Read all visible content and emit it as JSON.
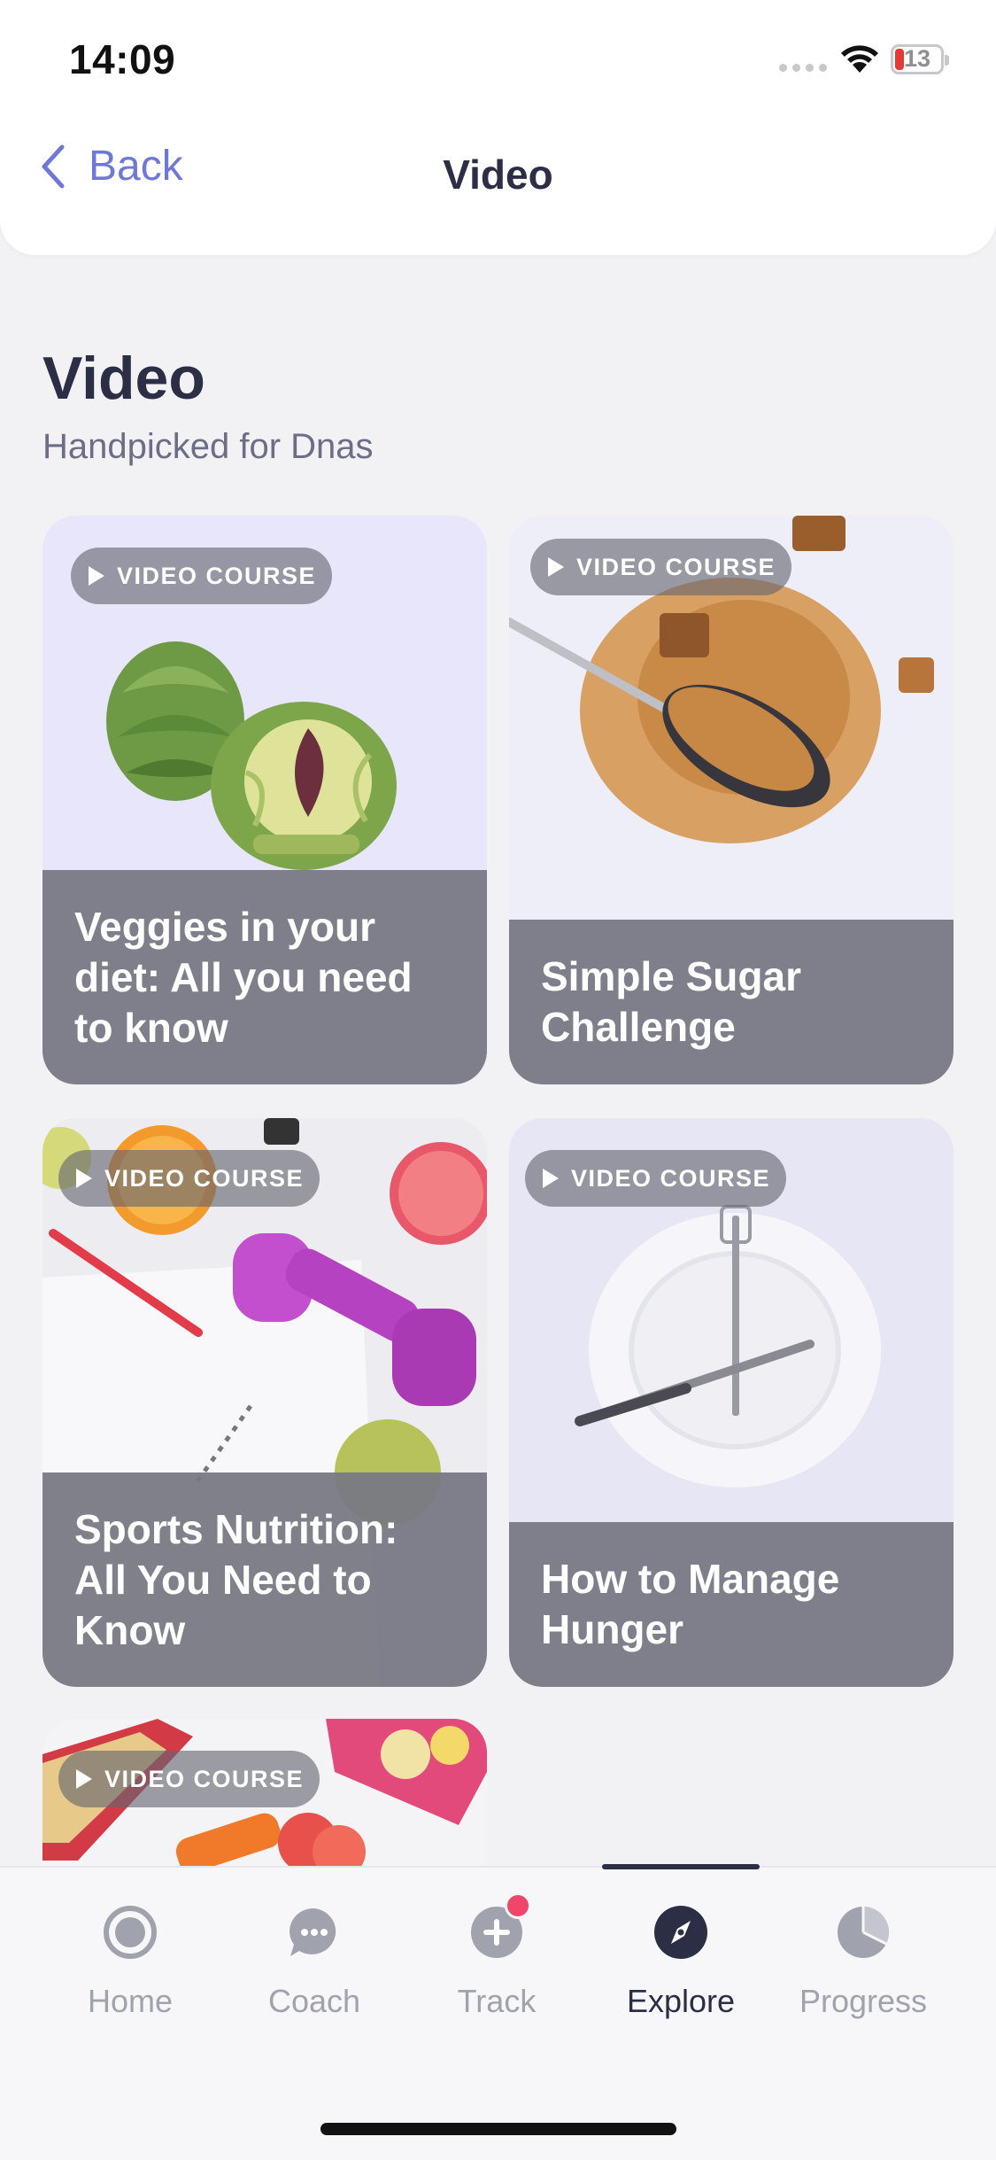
{
  "status_bar": {
    "time": "14:09",
    "battery": "13"
  },
  "header": {
    "back_label": "Back",
    "title": "Video"
  },
  "page": {
    "heading": "Video",
    "subheading": "Handpicked for Dnas"
  },
  "badge_label": "VIDEO COURSE",
  "cards": [
    {
      "title": "Veggies in your diet: All you need to know",
      "image": "artichoke-image"
    },
    {
      "title": "Simple Sugar Challenge",
      "image": "brown-sugar-image"
    },
    {
      "title": "Sports Nutrition: All You Need to Know",
      "image": "dumbbell-fruit-image"
    },
    {
      "title": "How to Manage Hunger",
      "image": "plate-cutlery-image"
    },
    {
      "title": "",
      "image": "lunchbox-image"
    }
  ],
  "tabbar": {
    "items": [
      {
        "label": "Home",
        "icon": "home-icon",
        "active": false
      },
      {
        "label": "Coach",
        "icon": "chat-bubble-icon",
        "active": false
      },
      {
        "label": "Track",
        "icon": "plus-circle-icon",
        "active": false,
        "notification": true
      },
      {
        "label": "Explore",
        "icon": "compass-icon",
        "active": true
      },
      {
        "label": "Progress",
        "icon": "pie-chart-icon",
        "active": false
      }
    ]
  },
  "colors": {
    "accent": "#6f78d6",
    "text_dark": "#2b2e45",
    "caption_bg": "#78787f",
    "notification": "#f0466c"
  }
}
